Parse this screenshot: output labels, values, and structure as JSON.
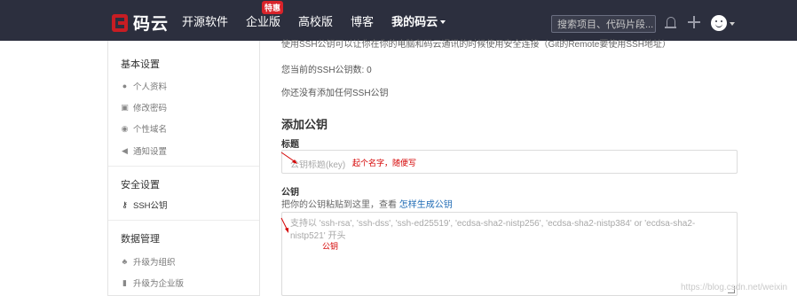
{
  "brand": {
    "name": "码云",
    "accent": "#c71d23",
    "topbar_bg": "#2c2f3e"
  },
  "nav": {
    "items": [
      {
        "label": "开源软件"
      },
      {
        "label": "企业版",
        "badge": "特惠"
      },
      {
        "label": "高校版"
      },
      {
        "label": "博客"
      },
      {
        "label": "我的码云"
      }
    ]
  },
  "search": {
    "placeholder": "搜索项目、代码片段..."
  },
  "sidebar": {
    "sections": [
      {
        "title": "基本设置",
        "items": [
          {
            "label": "个人资料",
            "icon": "user-icon"
          },
          {
            "label": "修改密码",
            "icon": "lock-icon"
          },
          {
            "label": "个性域名",
            "icon": "globe-icon"
          },
          {
            "label": "通知设置",
            "icon": "speaker-icon"
          }
        ]
      },
      {
        "title": "安全设置",
        "items": [
          {
            "label": "SSH公钥",
            "icon": "key-icon",
            "active": true
          }
        ]
      },
      {
        "title": "数据管理",
        "items": [
          {
            "label": "升级为组织",
            "icon": "group-icon"
          },
          {
            "label": "升级为企业版",
            "icon": "building-icon"
          }
        ]
      }
    ]
  },
  "main": {
    "intro_line": "使用SSH公钥可以让你在你的电脑和码云通讯的时候使用安全连接（Git的Remote要使用SSH地址）",
    "ssh_count": "您当前的SSH公钥数: 0",
    "no_keys": "你还没有添加任何SSH公钥",
    "add_title": "添加公钥",
    "title_label": "标题",
    "title_placeholder": "公钥标题(key)",
    "title_annotation": "起个名字，随便写",
    "key_label": "公钥",
    "key_hint": "把你的公钥粘贴到这里，查看",
    "key_hint_link": "怎样生成公钥",
    "key_placeholder": "支持以 'ssh-rsa', 'ssh-dss', 'ssh-ed25519', 'ecdsa-sha2-nistp256', 'ecdsa-sha2-nistp384' or 'ecdsa-sha2-nistp521' 开头",
    "key_annotation": "公钥"
  },
  "watermark": "https://blog.csdn.net/weixin"
}
